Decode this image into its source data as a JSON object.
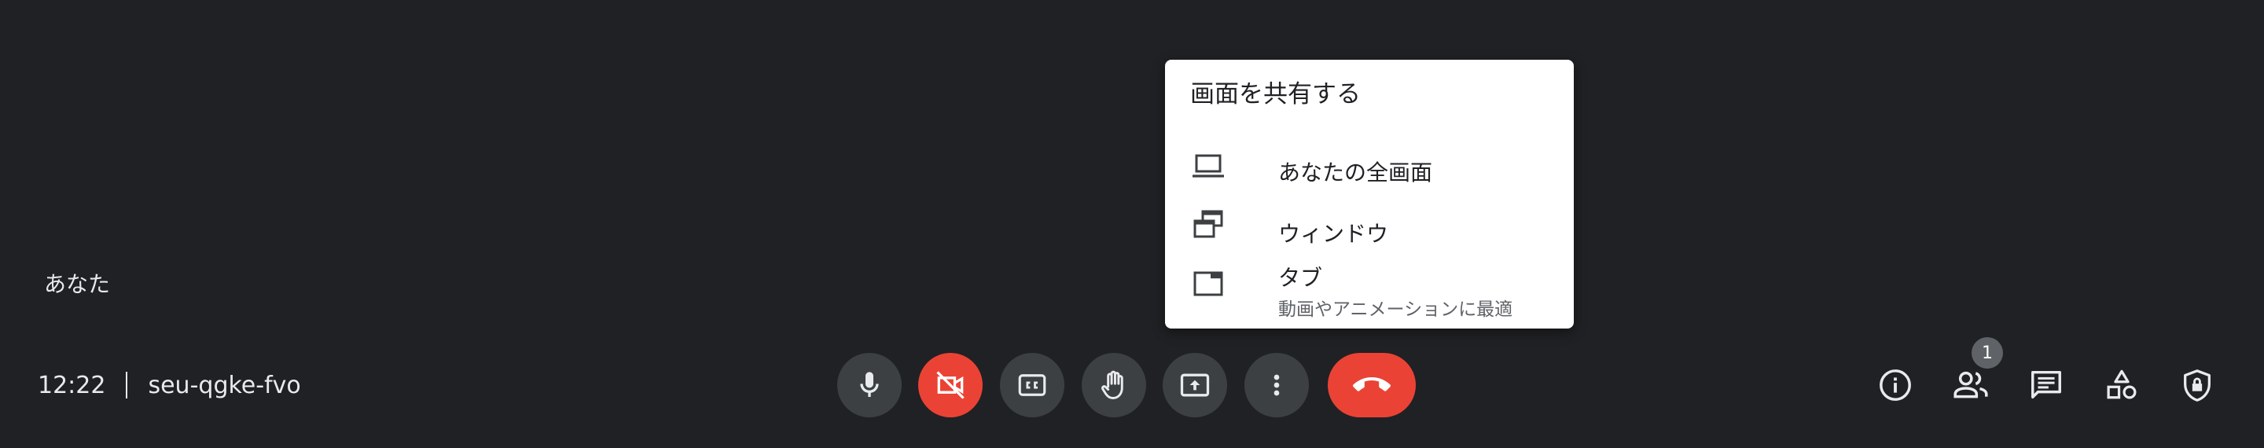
{
  "self_label": "あなた",
  "meeting": {
    "time": "12:22",
    "code": "seu-qgke-fvo"
  },
  "controls": [
    {
      "name": "microphone",
      "icon": "mic-icon"
    },
    {
      "name": "camera-off",
      "icon": "videocam-off-icon",
      "color": "#ea4335"
    },
    {
      "name": "captions",
      "icon": "closed-caption-icon"
    },
    {
      "name": "raise-hand",
      "icon": "hand-icon"
    },
    {
      "name": "present",
      "icon": "present-screen-icon"
    },
    {
      "name": "more-options",
      "icon": "more-vert-icon"
    },
    {
      "name": "leave-call",
      "icon": "call-end-icon",
      "color": "#ea4335"
    }
  ],
  "right_icons": [
    {
      "name": "meeting-details",
      "icon": "info-icon"
    },
    {
      "name": "people",
      "icon": "people-icon",
      "badge": "1"
    },
    {
      "name": "chat",
      "icon": "chat-icon"
    },
    {
      "name": "activities",
      "icon": "shapes-icon"
    },
    {
      "name": "host-controls",
      "icon": "shield-lock-icon"
    }
  ],
  "share_menu": {
    "title": "画面を共有する",
    "items": [
      {
        "label": "あなたの全画面",
        "icon": "laptop-icon"
      },
      {
        "label": "ウィンドウ",
        "icon": "windows-icon"
      },
      {
        "label": "タブ",
        "sub": "動画やアニメーションに最適",
        "icon": "tab-icon"
      }
    ]
  },
  "colors": {
    "background": "#202124",
    "control_bg": "#3c4043",
    "danger": "#ea4335",
    "menu_bg": "#ffffff"
  }
}
